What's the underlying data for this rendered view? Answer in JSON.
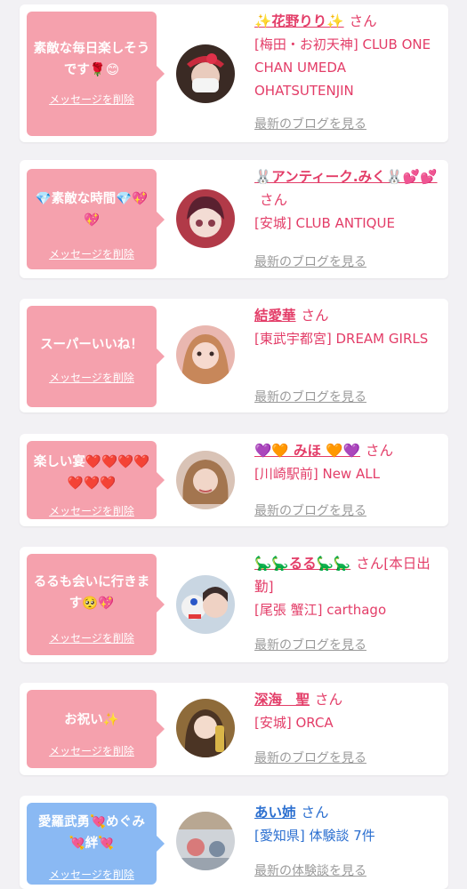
{
  "messages": [
    {
      "comment": "素敵な毎日楽しそうです🌹😊",
      "delete_label": "メッセージを削除",
      "name": "✨花野りり✨",
      "suffix": "さん",
      "shop": "[梅田・お初天神] CLUB ONE CHAN UMEDA OHATSUTENJIN",
      "more_label": "最新のブログを見る",
      "bubble_color": "#f5a1ad"
    },
    {
      "comment": "💎素敵な時間💎💖💖",
      "delete_label": "メッセージを削除",
      "name": "🐰アンティーク.みく🐰💕💕",
      "suffix": "さん",
      "shop": "[安城] CLUB ANTIQUE",
      "more_label": "最新のブログを見る",
      "bubble_color": "#f5a1ad"
    },
    {
      "comment": "スーパーいいね！",
      "delete_label": "メッセージを削除",
      "name": "結愛華",
      "suffix": "さん",
      "shop": "[東武宇都宮] DREAM GIRLS",
      "more_label": "最新のブログを見る",
      "bubble_color": "#f5a1ad"
    },
    {
      "comment": "楽しい宴❤️❤️❤️❤️❤️❤️❤️",
      "delete_label": "メッセージを削除",
      "name": "💜🧡 みほ 🧡💜",
      "suffix": "さん",
      "shop": "[川崎駅前] New ALL",
      "more_label": "最新のブログを見る",
      "bubble_color": "#f5a1ad"
    },
    {
      "comment": "るるも会いに行きます🥺💖",
      "delete_label": "メッセージを削除",
      "name": "🦕🦕るる🦕🦕",
      "suffix": "さん[本日出勤]",
      "shop": "[尾張 蟹江] carthago",
      "more_label": "最新のブログを見る",
      "bubble_color": "#f5a1ad"
    },
    {
      "comment": "お祝い✨",
      "delete_label": "メッセージを削除",
      "name": "深海　聖",
      "suffix": "さん",
      "shop": "[安城] ORCA",
      "more_label": "最新のブログを見る",
      "bubble_color": "#f5a1ad"
    },
    {
      "comment": "愛羅武勇💘めぐみ💘絆💘",
      "delete_label": "メッセージを削除",
      "name": "あい姉",
      "suffix": "さん",
      "shop": "[愛知県] 体験談 7件",
      "more_label": "最新の体験談を見る",
      "bubble_color": "#8ab9f3"
    }
  ]
}
